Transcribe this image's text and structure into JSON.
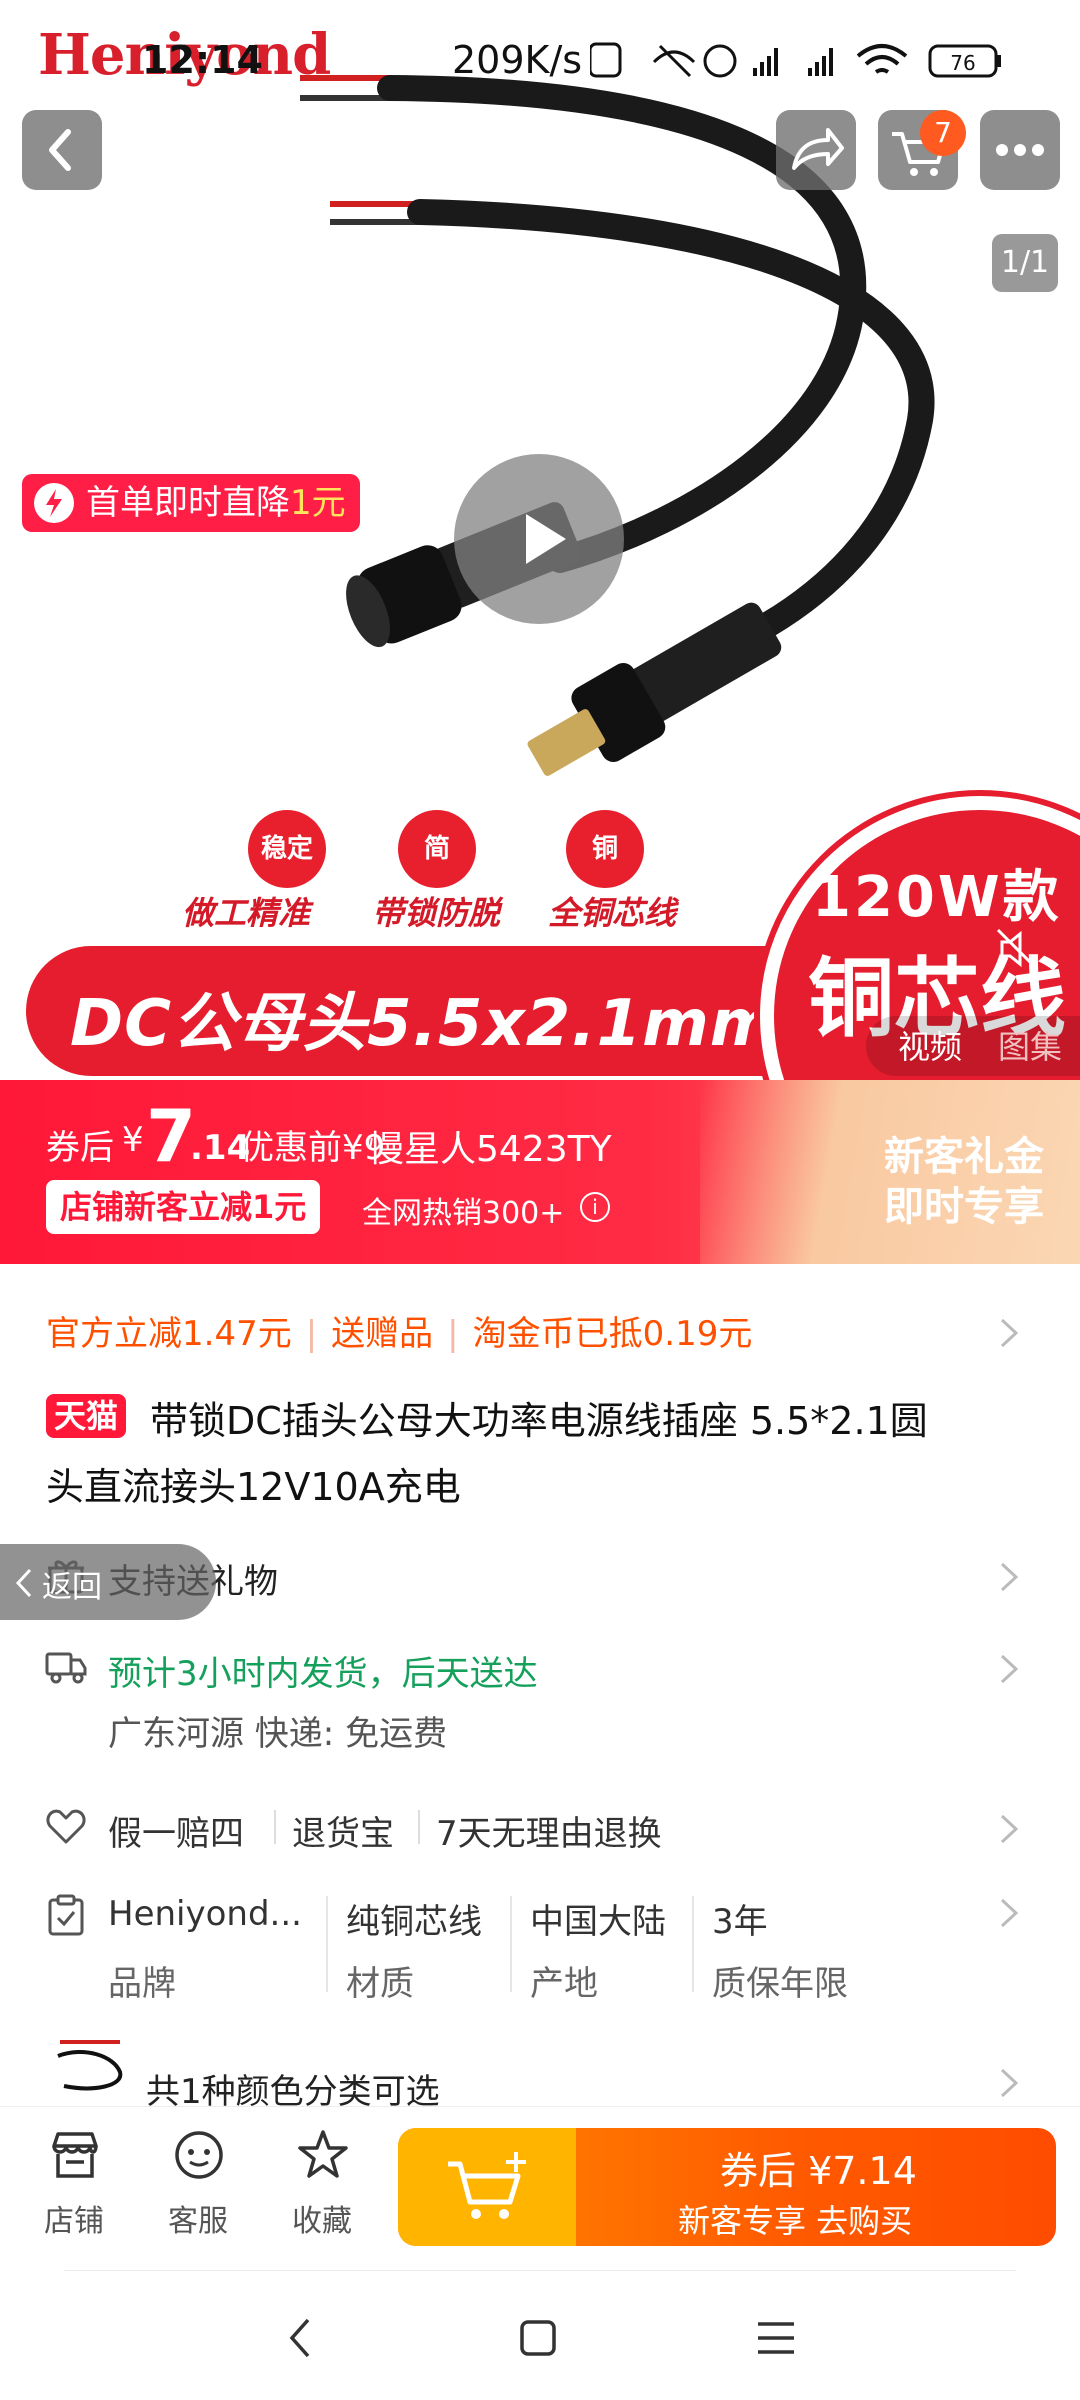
{
  "status_bar": {
    "time": "12:14",
    "speed": "209K/s",
    "battery": "76"
  },
  "hero": {
    "watermark": "Heniyond",
    "image_counter": "1/1",
    "cart_count": "7",
    "promo_tag": {
      "text": "首单即时直降",
      "highlight": "1元"
    },
    "badges": [
      {
        "circle": "稳定",
        "label": "做工精准"
      },
      {
        "circle": "简",
        "label": "带锁防脱"
      },
      {
        "circle": "铜",
        "label": "全铜芯线"
      }
    ],
    "band_text": "DC公母头5.5x2.1mm",
    "power_line1": "120W款",
    "power_line2": "铜芯线",
    "media_tabs": [
      "视频",
      "图集"
    ]
  },
  "price_banner": {
    "label": "券后",
    "currency": "¥",
    "price_int": "7",
    "price_dec": ".14",
    "original_label": "优惠前¥9",
    "live_viewer": "慢星人5423TY",
    "shop_chip": "店铺新客立减1元",
    "sales": "全网热销300+",
    "info_icon": "i",
    "gift_line1": "新客礼金",
    "gift_line2": "即时专享"
  },
  "benefits": [
    "官方立减1.47元",
    "送赠品",
    "淘金币已抵0.19元"
  ],
  "product": {
    "tag": "天猫",
    "title_line1": "带锁DC插头公母大功率电源线插座 5.5*2.1圆",
    "title_line2": "头直流接头12V10A充电"
  },
  "return_float": "返回",
  "gift_row": "支持送礼物",
  "shipping": {
    "eta": "预计3小时内发货，后天送达",
    "origin": "广东河源 快递: 免运费"
  },
  "guarantees": [
    "假一赔四",
    "退货宝",
    "7天无理由退换"
  ],
  "attributes": [
    {
      "value": "Heniyond...",
      "key": "品牌"
    },
    {
      "value": "纯铜芯线",
      "key": "材质"
    },
    {
      "value": "中国大陆",
      "key": "产地"
    },
    {
      "value": "3年",
      "key": "质保年限"
    }
  ],
  "color_row": "共1种颜色分类可选",
  "bottom_bar": {
    "shop": "店铺",
    "service": "客服",
    "favorite": "收藏",
    "buy_line1": "券后 ¥7.14",
    "buy_line2": "新客专享 去购买"
  },
  "colors": {
    "brand_red": "#ff1838",
    "accent_orange": "#ff5000",
    "green": "#15a05c",
    "buy_gradient_start": "#ff8a00",
    "buy_gradient_end": "#ff4c00"
  },
  "icons": [
    "back-icon",
    "share-icon",
    "cart-icon",
    "more-icon",
    "play-icon",
    "mute-icon",
    "gift-icon",
    "truck-icon",
    "shield-heart-icon",
    "clipboard-icon",
    "shop-icon",
    "service-icon",
    "star-icon",
    "add-cart-icon",
    "nav-back-icon",
    "nav-home-icon",
    "nav-menu-icon"
  ]
}
